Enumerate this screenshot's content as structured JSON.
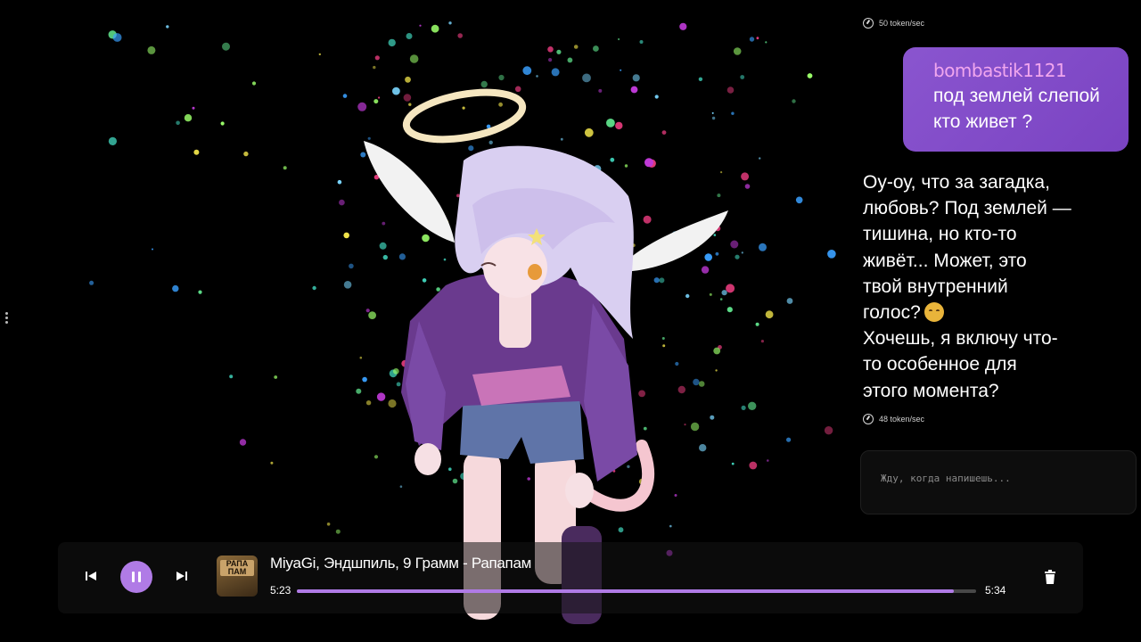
{
  "chat": {
    "top_speed": "50 token/sec",
    "user_message": {
      "username": "bombastik1121",
      "text_lines": [
        "под землей слепой",
        "кто живет ?"
      ]
    },
    "reply_lines": [
      "Оу-оу, что за загадка,",
      "любовь? Под землей —",
      "тишина, но кто-то",
      "живёт... Может, это",
      "твой внутренний",
      "голос?",
      "Хочешь, я включу что-",
      "то особенное для",
      "этого момента?"
    ],
    "reply_emoji": "smiling-face-emoji",
    "reply_speed": "48 token/sec",
    "input_placeholder": "Жду, когда напишешь..."
  },
  "player": {
    "track_title": "MiyaGi, Эндшпиль, 9 Грамм - Рапапам",
    "current_time": "5:23",
    "total_time": "5:34",
    "progress": 0.967,
    "cover_text": "РАПА ПАМ",
    "state": "playing",
    "icons": [
      "skip-previous-icon",
      "pause-icon",
      "skip-next-icon",
      "trash-icon"
    ]
  },
  "colors": {
    "accent": "#b07be6",
    "user_bubble": "#7f49c7",
    "username": "#f1a6ee",
    "background": "#000000"
  }
}
